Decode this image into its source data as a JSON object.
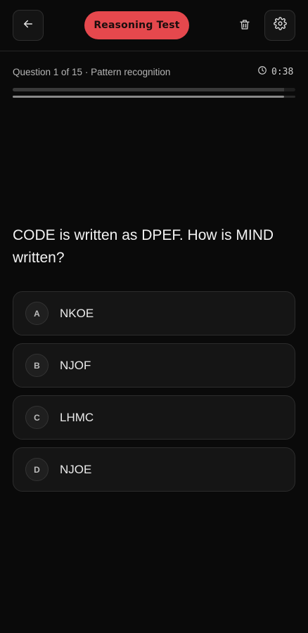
{
  "header": {
    "title": "Reasoning Test",
    "icons": {
      "back": "arrow-left-icon",
      "delete": "trash-icon",
      "settings": "gear-icon"
    }
  },
  "meta": {
    "label": "Question 1 of 15 · Pattern recognition",
    "timer": "0:38",
    "progress_fraction": 0.96
  },
  "question": {
    "text": "CODE is written as DPEF. How is MIND written?",
    "options": [
      {
        "letter": "A",
        "text": "NKOE"
      },
      {
        "letter": "B",
        "text": "NJOF"
      },
      {
        "letter": "C",
        "text": "LHMC"
      },
      {
        "letter": "D",
        "text": "NJOE"
      }
    ]
  },
  "colors": {
    "accent": "#e5484d",
    "background": "#0a0a0a"
  }
}
